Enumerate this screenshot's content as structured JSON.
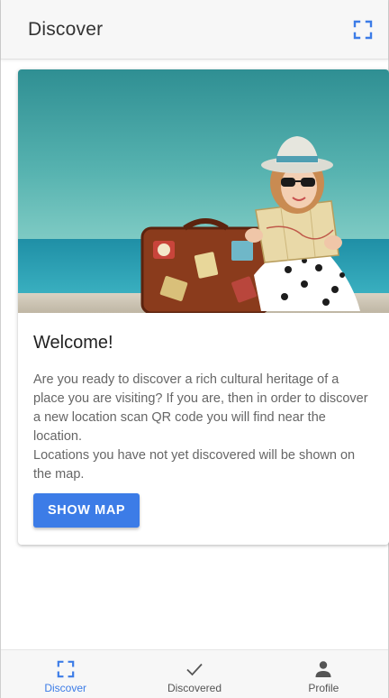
{
  "header": {
    "title": "Discover",
    "scan_icon": "qr-scan-icon"
  },
  "card": {
    "image_icon": "hero-photo-girl-suitcase-map",
    "title": "Welcome!",
    "paragraph_1": "Are you ready to discover a rich cultural heritage of a place you are visiting? If you are, then in order to discover a new location scan QR code you will find near the location.",
    "paragraph_2": "Locations you have not yet discovered will be shown on the map.",
    "button_label": "SHOW MAP"
  },
  "nav": {
    "items": [
      {
        "label": "Discover",
        "icon": "qr-scan-icon",
        "active": true
      },
      {
        "label": "Discovered",
        "icon": "check-icon",
        "active": false
      },
      {
        "label": "Profile",
        "icon": "person-icon",
        "active": false
      }
    ]
  },
  "colors": {
    "accent": "#3c7ce7",
    "header_bg": "#f7f7f7",
    "text_muted": "#666666"
  }
}
